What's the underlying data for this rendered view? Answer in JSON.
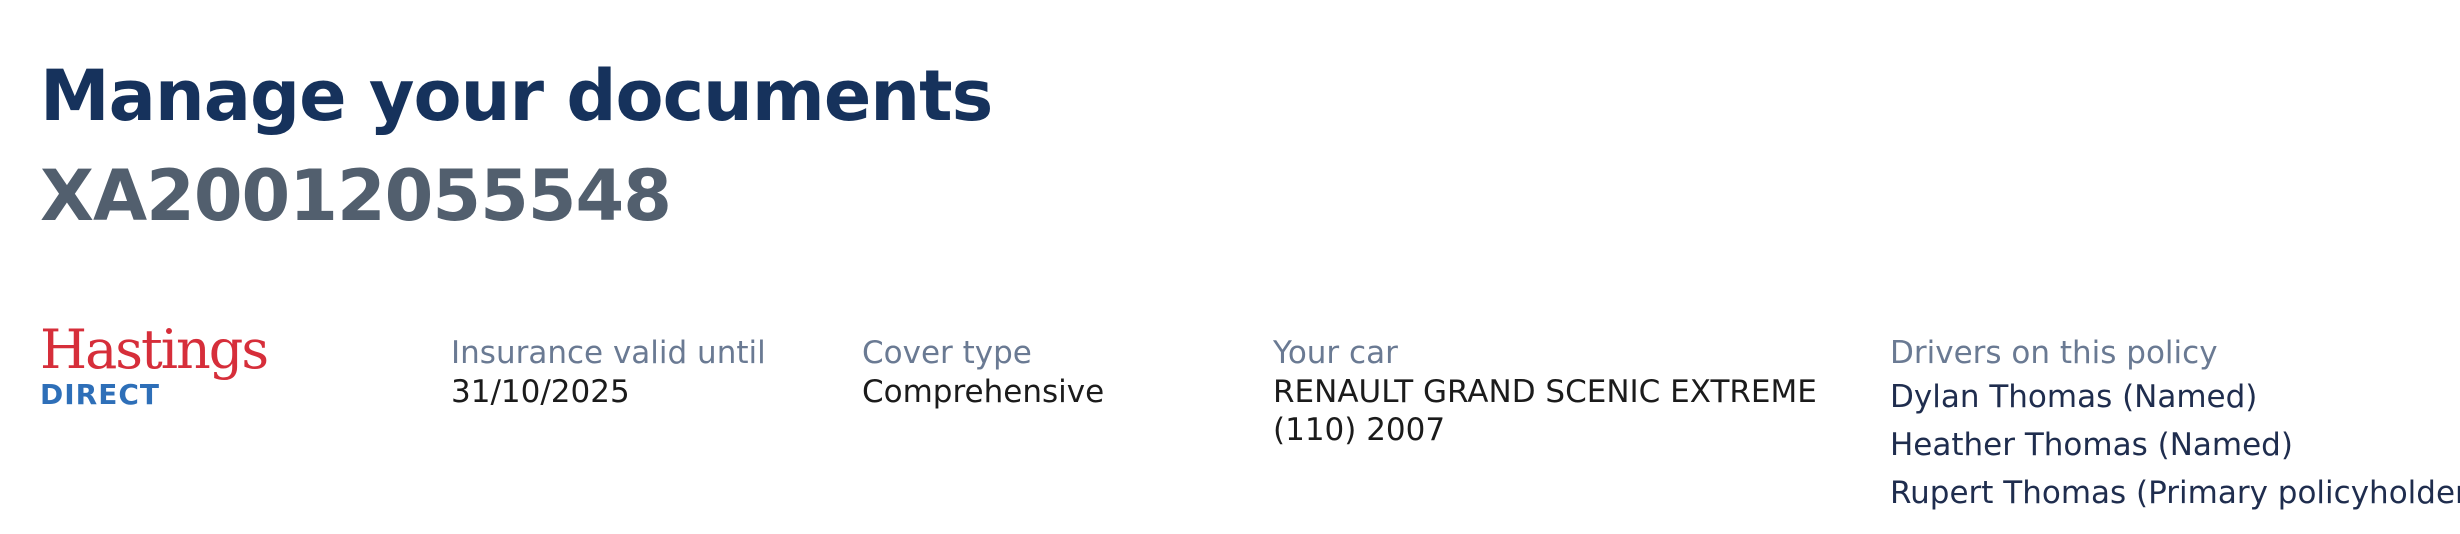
{
  "header": {
    "title": "Manage your documents",
    "policy_number": "XA20012055548"
  },
  "logo": {
    "main": "Hastings",
    "sub": "DIRECT"
  },
  "summary": {
    "valid_until": {
      "label": "Insurance valid until",
      "value": "31/10/2025"
    },
    "cover_type": {
      "label": "Cover type",
      "value": "Comprehensive"
    },
    "car": {
      "label": "Your car",
      "line1": "RENAULT GRAND SCENIC EXTREME",
      "line2": "(110) 2007"
    },
    "drivers": {
      "label": "Drivers on this policy",
      "items": [
        "Dylan Thomas (Named)",
        "Heather Thomas (Named)",
        "Rupert Thomas (Primary policyholder)"
      ]
    }
  },
  "colors": {
    "title": "#16325c",
    "policy_number": "#525f6e",
    "label": "#6a7a93",
    "logo_red": "#d62e3a",
    "logo_blue": "#2e6fb8"
  }
}
